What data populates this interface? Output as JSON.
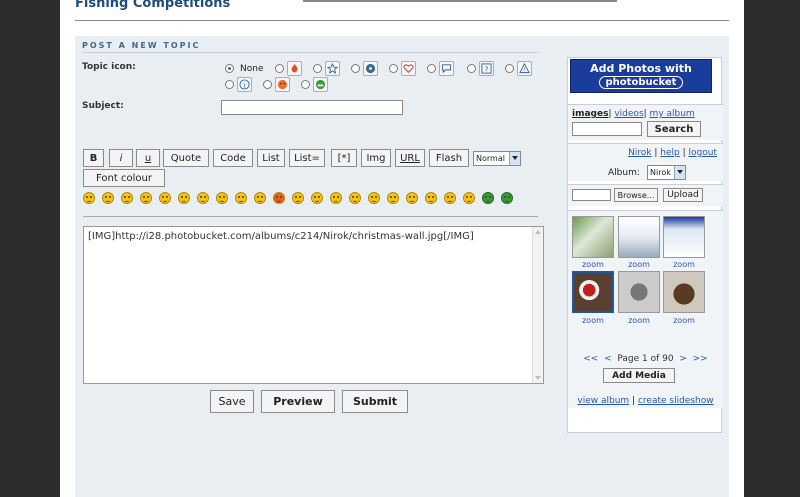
{
  "page": {
    "title": "Fishing Competitions"
  },
  "section": {
    "header": "POST A NEW TOPIC"
  },
  "form": {
    "topic_icon_label": "Topic icon:",
    "none_label": "None",
    "subject_label": "Subject:",
    "subject_value": "",
    "message": "[IMG]http://i28.photobucket.com/albums/c214/Nirok/christmas-wall.jpg[/IMG]"
  },
  "toolbar": {
    "bold": "B",
    "italic": "i",
    "underline": "u",
    "quote": "Quote",
    "code": "Code",
    "list": "List",
    "list_eq": "List=",
    "bullet": "[*]",
    "img": "Img",
    "url": "URL",
    "flash": "Flash",
    "size_value": "Normal",
    "font_colour": "Font colour"
  },
  "actions": {
    "save": "Save",
    "preview": "Preview",
    "submit": "Submit"
  },
  "photobucket": {
    "banner_line1": "Add Photos with",
    "banner_line2": "photobucket",
    "tab_images": "images",
    "tab_videos": "videos",
    "tab_album": "my album",
    "search": "Search",
    "user": "Nirok",
    "help": "help",
    "logout": "logout",
    "album_label": "Album:",
    "album_value": "Nirok",
    "browse": "Browse...",
    "upload": "Upload",
    "zoom": "zoom",
    "page_prev2": "<<",
    "page_prev": "<",
    "page_info": "Page 1 of 90",
    "page_next": ">",
    "page_next2": ">>",
    "add_media": "Add Media",
    "view_album": "view album",
    "create_slideshow": "create slideshow"
  },
  "colors": {
    "accent": "#1f4e79",
    "panel": "#e9eef2",
    "photobucket_blue": "#1a3c9a",
    "link": "#2858a8"
  }
}
